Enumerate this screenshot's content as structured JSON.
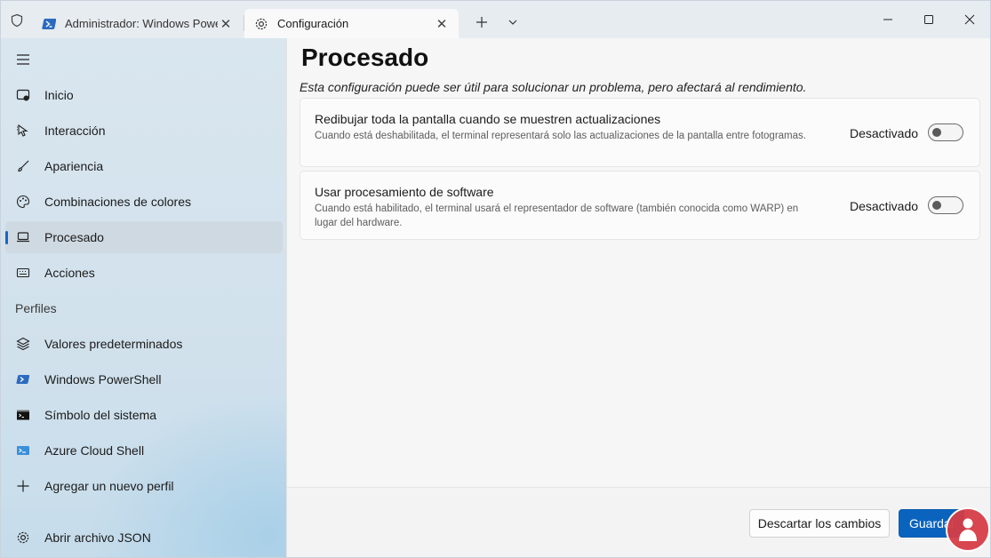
{
  "titlebar": {
    "tabs": [
      {
        "title": "Administrador: Windows Powe",
        "icon": "powershell-icon",
        "active": false
      },
      {
        "title": "Configuración",
        "icon": "gear-icon",
        "active": true
      }
    ],
    "new_tab_icon": "plus-icon",
    "dropdown_icon": "chevron-down-icon",
    "window_controls": [
      "minimize-icon",
      "maximize-icon",
      "close-icon"
    ]
  },
  "sidebar": {
    "items": [
      {
        "label": "Inicio",
        "icon": "home-icon"
      },
      {
        "label": "Interacción",
        "icon": "cursor-icon"
      },
      {
        "label": "Apariencia",
        "icon": "brush-icon"
      },
      {
        "label": "Combinaciones de colores",
        "icon": "palette-icon"
      },
      {
        "label": "Procesado",
        "icon": "laptop-icon",
        "selected": true
      },
      {
        "label": "Acciones",
        "icon": "keyboard-icon"
      }
    ],
    "profiles_header": "Perfiles",
    "profiles": [
      {
        "label": "Valores predeterminados",
        "icon": "layers-icon"
      },
      {
        "label": "Windows PowerShell",
        "icon": "powershell-icon"
      },
      {
        "label": "Símbolo del sistema",
        "icon": "cmd-icon"
      },
      {
        "label": "Azure Cloud Shell",
        "icon": "azure-icon"
      },
      {
        "label": "Agregar un nuevo perfil",
        "icon": "plus-icon"
      }
    ],
    "open_json": {
      "label": "Abrir archivo JSON",
      "icon": "gear-icon"
    }
  },
  "main": {
    "title": "Procesado",
    "description": "Esta configuración puede ser útil para solucionar un problema, pero afectará al rendimiento.",
    "settings": [
      {
        "title": "Redibujar toda la pantalla cuando se muestren actualizaciones",
        "description": "Cuando está deshabilitada, el terminal representará solo las actualizaciones de la pantalla entre fotogramas.",
        "state": "Desactivado",
        "on": false
      },
      {
        "title": "Usar procesamiento de software",
        "description": "Cuando está habilitado, el terminal usará el representador de software (también conocida como WARP) en lugar del hardware.",
        "state": "Desactivado",
        "on": false
      }
    ],
    "footer": {
      "discard_label": "Descartar los cambios",
      "save_label": "Guardar"
    }
  },
  "colors": {
    "accent": "#0a64be",
    "selected_indicator": "#1a66c2"
  }
}
